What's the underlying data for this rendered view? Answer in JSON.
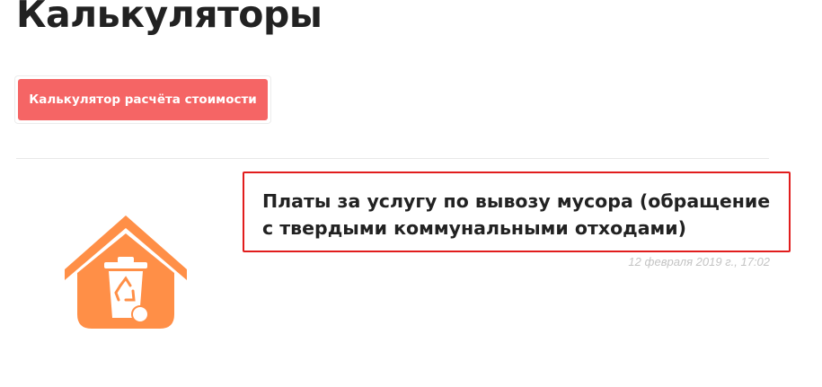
{
  "page": {
    "title": "Калькуляторы"
  },
  "toolbar": {
    "calculator_button_label": "Калькулятор расчёта стоимости"
  },
  "article": {
    "title": "Платы за услугу по вывозу мусора (обращение с твердыми коммунальными отходами)",
    "date": "12 февраля 2019 г., 17:02",
    "icon": "recycle-bin-house-icon"
  },
  "colors": {
    "button_bg": "#f56565",
    "highlight_border": "#e11d1d",
    "icon_orange": "#ff8f47",
    "date_text": "#c4c4c4"
  }
}
